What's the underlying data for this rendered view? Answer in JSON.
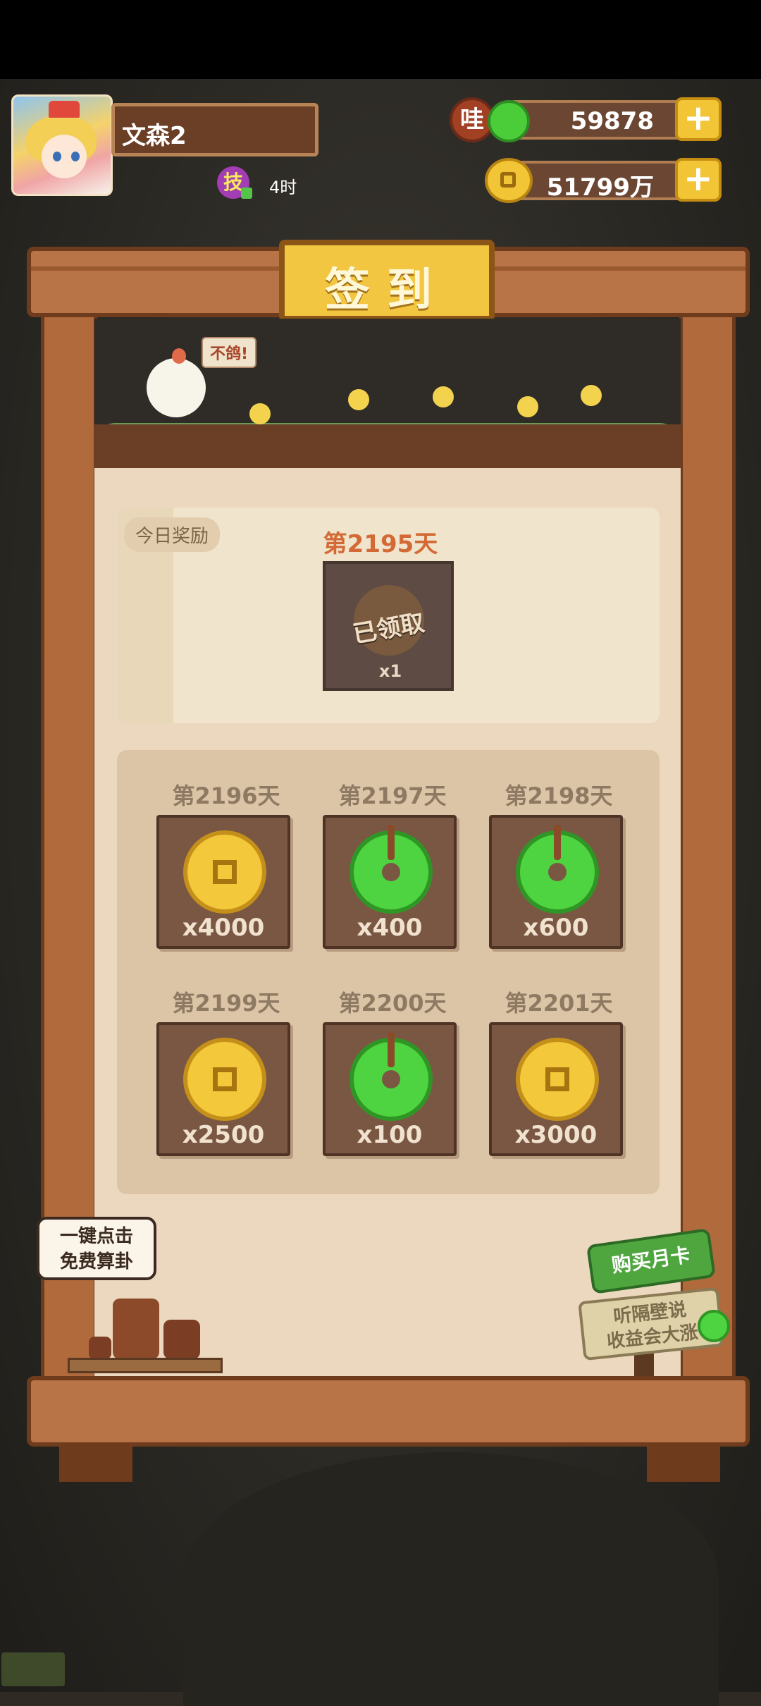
{
  "player": {
    "name": "文森2",
    "skill_icon_label": "技",
    "skill_time": "4时"
  },
  "currency": {
    "badge_label": "哇",
    "jade_amount": "59878",
    "coin_amount": "51799万",
    "plus_label": "+"
  },
  "title": "签到",
  "scene": {
    "chick_bubble": "不鸽!"
  },
  "today": {
    "tag": "今日奖励",
    "day": "第2195天",
    "status": "已领取",
    "qty": "x1"
  },
  "upcoming": [
    {
      "day": "第2196天",
      "type": "coin",
      "qty": "x4000"
    },
    {
      "day": "第2197天",
      "type": "jade",
      "qty": "x400"
    },
    {
      "day": "第2198天",
      "type": "jade",
      "qty": "x600"
    },
    {
      "day": "第2199天",
      "type": "coin",
      "qty": "x2500"
    },
    {
      "day": "第2200天",
      "type": "jade",
      "qty": "x100"
    },
    {
      "day": "第2201天",
      "type": "coin",
      "qty": "x3000"
    }
  ],
  "fortune": {
    "line1": "一键点击",
    "line2": "免费算卦"
  },
  "month_card": {
    "title": "购买月卡",
    "line1": "听隔壁说",
    "line2": "收益会大涨"
  },
  "colors": {
    "wood": "#b87446",
    "panel": "#ecd8be",
    "accent_orange": "#d36a35",
    "gold": "#f3c83a",
    "jade": "#4ed441"
  }
}
